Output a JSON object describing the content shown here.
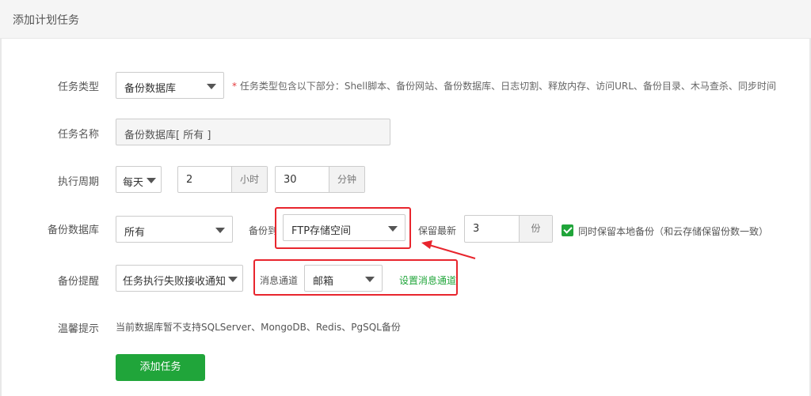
{
  "header": {
    "title": "添加计划任务"
  },
  "task_type": {
    "label": "任务类型",
    "value": "备份数据库",
    "hint_star": "*",
    "hint": "任务类型包含以下部分：Shell脚本、备份网站、备份数据库、日志切割、释放内存、访问URL、备份目录、木马查杀、同步时间"
  },
  "task_name": {
    "label": "任务名称",
    "value": "备份数据库[ 所有 ]"
  },
  "period": {
    "label": "执行周期",
    "freq": "每天",
    "hours": "2",
    "hours_unit": "小时",
    "minutes": "30",
    "minutes_unit": "分钟"
  },
  "backup_db": {
    "label": "备份数据库",
    "db": "所有",
    "to_label": "备份到",
    "to_value": "FTP存储空间",
    "keep_label": "保留最新",
    "keep_value": "3",
    "keep_unit": "份",
    "checkbox_label": "同时保留本地备份（和云存储保留份数一致）",
    "checkbox_checked": true
  },
  "reminder": {
    "label": "备份提醒",
    "value": "任务执行失败接收通知",
    "channel_label": "消息通道",
    "channel_value": "邮箱",
    "set_channel_link": "设置消息通道"
  },
  "tips": {
    "label": "温馨提示",
    "text": "当前数据库暂不支持SQLServer、MongoDB、Redis、PgSQL备份"
  },
  "submit_button": "添加任务",
  "colors": {
    "accent": "#20a53a",
    "highlight": "#e8252d"
  }
}
